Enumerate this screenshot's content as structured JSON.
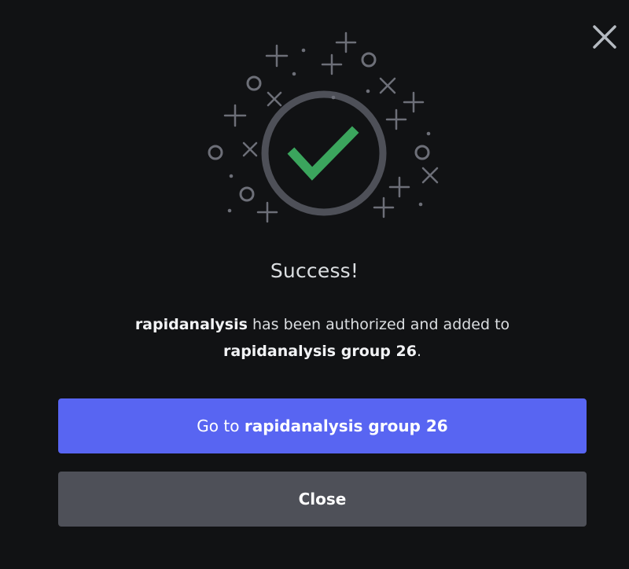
{
  "modal": {
    "close_icon": "close-icon",
    "illustration_icon": "success-checkmark-icon",
    "title": "Success!",
    "description": {
      "app_name": "rapidanalysis",
      "middle_text": " has been authorized and added to",
      "server_name": "rapidanalysis group 26",
      "end_text": "."
    },
    "primary_button": {
      "prefix": "Go to ",
      "server_name": "rapidanalysis group 26"
    },
    "secondary_button": {
      "label": "Close"
    }
  },
  "colors": {
    "background": "#111214",
    "primary": "#5865f2",
    "secondary": "#4e5058",
    "check": "#3ba55d",
    "ring": "#4e5058"
  }
}
